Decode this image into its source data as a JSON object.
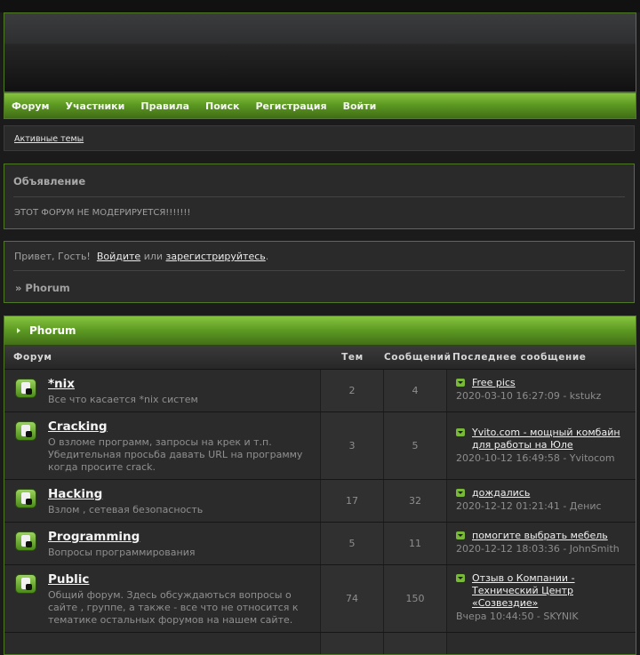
{
  "nav": [
    "Форум",
    "Участники",
    "Правила",
    "Поиск",
    "Регистрация",
    "Войти"
  ],
  "active_topics": "Активные темы",
  "announcement": {
    "title": "Объявление",
    "body": "ЭТОТ ФОРУМ НЕ МОДЕРИРУЕТСЯ!!!!!!!"
  },
  "welcome": {
    "greeting": "Привет, Гость!",
    "login": "Войдите",
    "or": "или",
    "register": "зарегистрируйтесь",
    "dot": ".",
    "crumb": "» Phorum"
  },
  "board": {
    "title": "Phorum",
    "columns": [
      "Форум",
      "Тем",
      "Сообщений",
      "Последнее сообщение"
    ],
    "rows": [
      {
        "name": "*nix",
        "desc": "Все что касается *nix систем",
        "topics": "2",
        "posts": "4",
        "last_title": "Free pics",
        "last_meta": "2020-03-10 16:27:09 - kstukz"
      },
      {
        "name": "Cracking",
        "desc": "О взломе программ, запросы на крек и т.п. Убедительная просьба давать URL на программу когда просите crack.",
        "topics": "3",
        "posts": "5",
        "last_title": "Yvito.com - мощный комбайн для работы на Юле",
        "last_meta": "2020-10-12 16:49:58 - Yvitocom"
      },
      {
        "name": "Hacking",
        "desc": "Взлом , сетевая безопасность",
        "topics": "17",
        "posts": "32",
        "last_title": "дождались",
        "last_meta": "2020-12-12 01:21:41 - Денис"
      },
      {
        "name": "Programming",
        "desc": "Вопросы программирования",
        "topics": "5",
        "posts": "11",
        "last_title": "помогите выбрать мебель",
        "last_meta": "2020-12-12 18:03:36 - JohnSmith"
      },
      {
        "name": "Public",
        "desc": "Общий форум. Здесь обсуждаються вопросы о сайте , группе, а также - все что не относится к тематике остальных форумов на нашем сайте.",
        "topics": "74",
        "posts": "150",
        "last_title": "Отзыв о Компании - Технический Центр «Созвездие»",
        "last_meta": "Вчера 10:44:50 - SKYNIK"
      }
    ]
  }
}
